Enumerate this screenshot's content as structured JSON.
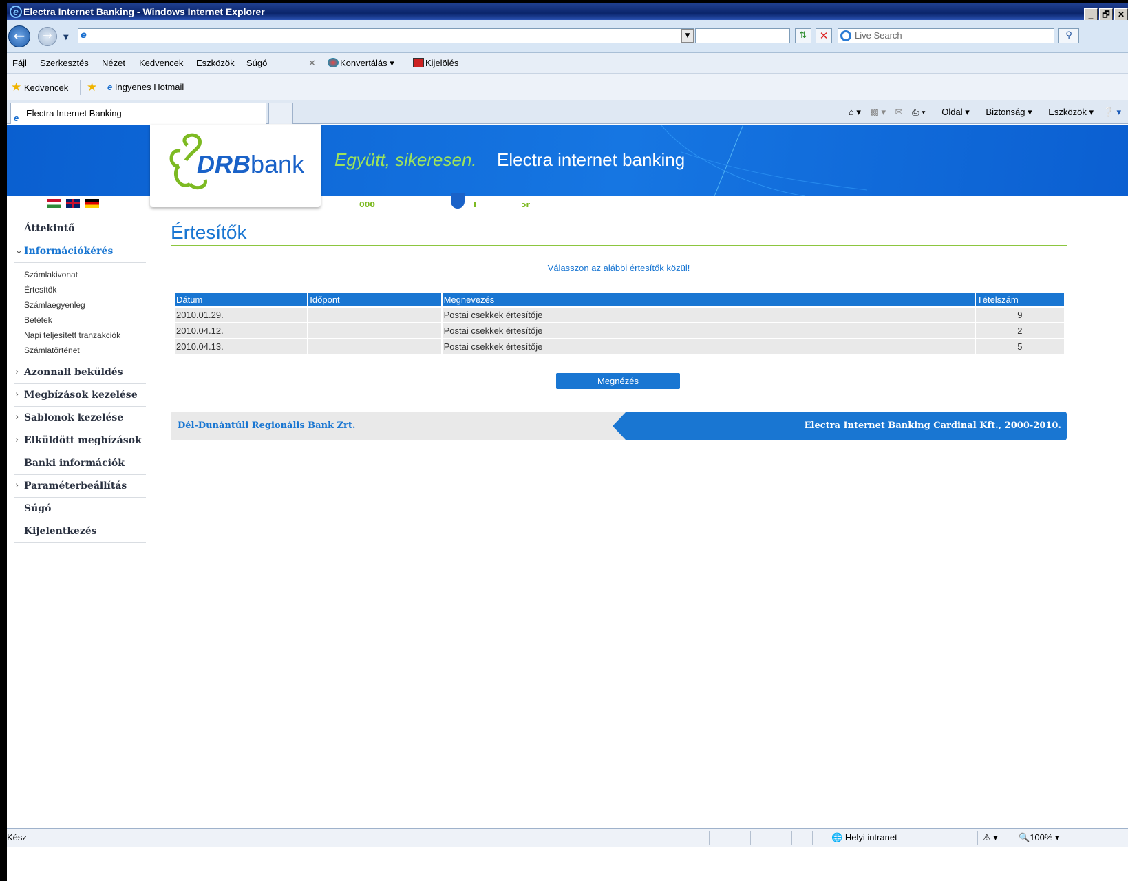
{
  "window": {
    "title": "Electra Internet Banking - Windows Internet Explorer",
    "controls": [
      "_",
      "🗗",
      "✕"
    ]
  },
  "addressbar": {
    "search_placeholder": "Live Search"
  },
  "menubar": {
    "items": [
      "Fájl",
      "Szerkesztés",
      "Nézet",
      "Kedvencek",
      "Eszközök",
      "Súgó"
    ],
    "convert": "Konvertálás",
    "select": "Kijelölés"
  },
  "favorites": {
    "label": "Kedvencek",
    "hotmail": "Ingyenes Hotmail"
  },
  "tab": {
    "title": "Electra Internet Banking"
  },
  "command": {
    "page": "Oldal",
    "security": "Biztonság",
    "tools": "Eszközök"
  },
  "banner": {
    "logo_bold": "DRB",
    "logo_light": "bank",
    "slogan": "Együtt, sikeresen.",
    "title": "Electra internet banking",
    "strip_a": "000",
    "strip_b": "I",
    "strip_c": "ɔr"
  },
  "sidebar": {
    "overview": "Áttekintő",
    "info": "Információkérés",
    "info_sub": [
      "Számlakivonat",
      "Értesítők",
      "Számlaegyenleg",
      "Betétek",
      "Napi teljesített tranzakciók",
      "Számlatörténet"
    ],
    "items": [
      "Azonnali beküldés",
      "Megbízások kezelése",
      "Sablonok kezelése",
      "Elküldött megbízások",
      "Banki információk",
      "Paraméterbeállítás",
      "Súgó",
      "Kijelentkezés"
    ]
  },
  "main": {
    "title": "Értesítők",
    "prompt": "Válasszon az alábbi értesítők közül!",
    "columns": [
      "Dátum",
      "Időpont",
      "Megnevezés",
      "Tételszám"
    ],
    "rows": [
      {
        "date": "2010.01.29.",
        "time": "",
        "name": "Postai csekkek értesítője",
        "count": "9"
      },
      {
        "date": "2010.04.12.",
        "time": "",
        "name": "Postai csekkek értesítője",
        "count": "2"
      },
      {
        "date": "2010.04.13.",
        "time": "",
        "name": "Postai csekkek értesítője",
        "count": "5"
      }
    ],
    "view_button": "Megnézés"
  },
  "footer": {
    "left": "Dél-Dunántúli Regionális Bank Zrt.",
    "right": "Electra Internet Banking Cardinal Kft., 2000-2010."
  },
  "status": {
    "left": "Kész",
    "zone": "Helyi intranet",
    "zoom": "100%"
  },
  "colors": {
    "accent": "#1976d2",
    "green": "#8cc63f",
    "banner": "#1676e2"
  }
}
